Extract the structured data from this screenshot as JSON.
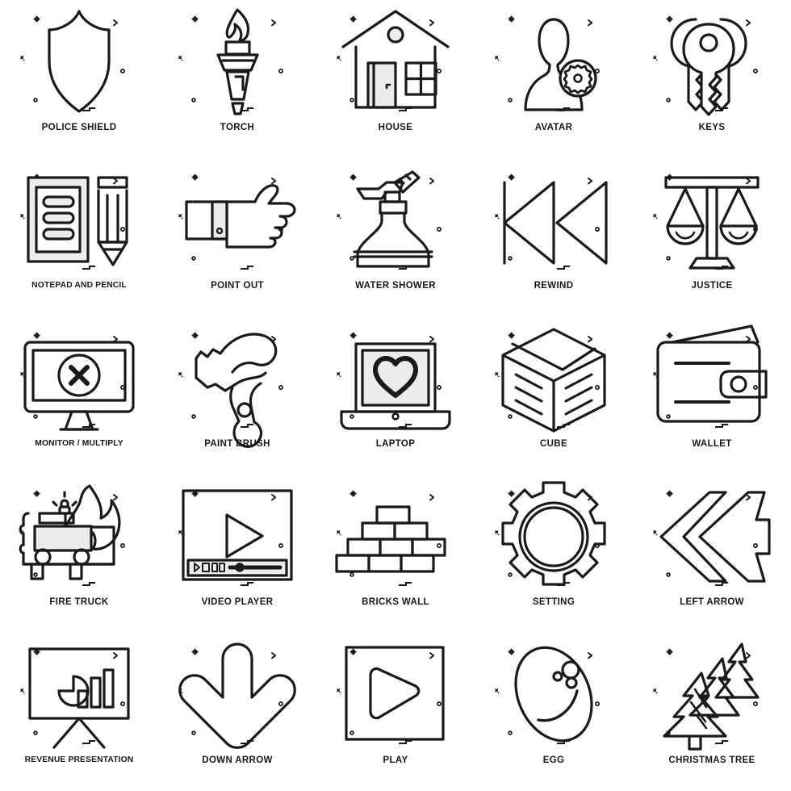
{
  "sheet": {
    "title": "Icon Set Sheet",
    "columns": 5,
    "rows": 5,
    "background_color": "#ffffff",
    "stroke_color": "#1a1a1a",
    "fill_tint_color": "#ececec",
    "label_color": "#18181a"
  },
  "icons": [
    {
      "id": "police-shield",
      "label": "POLICE SHIELD",
      "icon_name": "police-shield-icon"
    },
    {
      "id": "torch",
      "label": "TORCH",
      "icon_name": "torch-icon"
    },
    {
      "id": "house",
      "label": "HOUSE",
      "icon_name": "house-icon"
    },
    {
      "id": "avatar",
      "label": "AVATAR",
      "icon_name": "avatar-icon"
    },
    {
      "id": "keys",
      "label": "KEYS",
      "icon_name": "keys-icon"
    },
    {
      "id": "notepad-and-pencil",
      "label": "NOTEPAD AND PENCIL",
      "icon_name": "notepad-and-pencil-icon"
    },
    {
      "id": "point-out",
      "label": "POINT OUT",
      "icon_name": "pointing-hand-icon"
    },
    {
      "id": "water-shower",
      "label": "WATER SHOWER",
      "icon_name": "spray-bottle-icon"
    },
    {
      "id": "rewind",
      "label": "REWIND",
      "icon_name": "rewind-icon"
    },
    {
      "id": "justice",
      "label": "JUSTICE",
      "icon_name": "scales-of-justice-icon"
    },
    {
      "id": "monitor-multiply",
      "label": "MONITOR / MULTIPLY",
      "icon_name": "monitor-multiply-icon"
    },
    {
      "id": "paint-brush",
      "label": "PAINT BRUSH",
      "icon_name": "paint-roller-icon"
    },
    {
      "id": "laptop",
      "label": "LAPTOP",
      "icon_name": "laptop-heart-icon"
    },
    {
      "id": "cube",
      "label": "CUBE",
      "icon_name": "cube-icon"
    },
    {
      "id": "wallet",
      "label": "WALLET",
      "icon_name": "wallet-icon"
    },
    {
      "id": "fire-truck",
      "label": "FIRE TRUCK",
      "icon_name": "fire-truck-icon"
    },
    {
      "id": "video-player",
      "label": "VIDEO PLAYER",
      "icon_name": "video-player-icon"
    },
    {
      "id": "bricks-wall",
      "label": "BRICKS WALL",
      "icon_name": "bricks-wall-icon"
    },
    {
      "id": "setting",
      "label": "SETTING",
      "icon_name": "gear-icon"
    },
    {
      "id": "left-arrow",
      "label": "LEFT ARROW",
      "icon_name": "left-arrow-icon"
    },
    {
      "id": "revenue-presentation",
      "label": "REVENUE PRESENTATION",
      "icon_name": "presentation-chart-icon"
    },
    {
      "id": "down-arrow",
      "label": "DOWN ARROW",
      "icon_name": "down-arrow-icon"
    },
    {
      "id": "play",
      "label": "PLAY",
      "icon_name": "play-button-icon"
    },
    {
      "id": "egg",
      "label": "EGG",
      "icon_name": "egg-icon"
    },
    {
      "id": "christmas-tree",
      "label": "CHRISTMAS TREE",
      "icon_name": "christmas-tree-icon"
    }
  ]
}
